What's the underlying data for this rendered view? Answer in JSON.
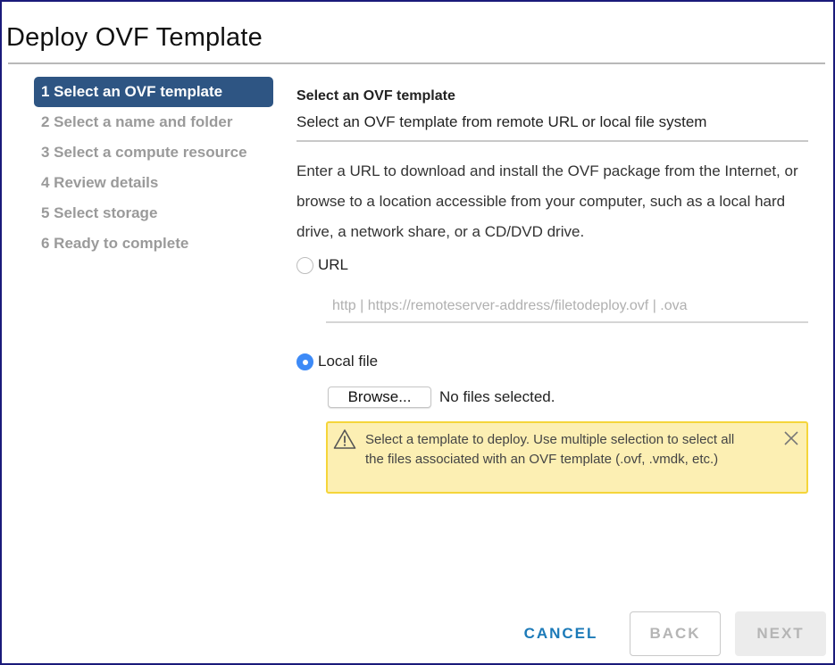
{
  "window": {
    "title": "Deploy OVF Template"
  },
  "steps": [
    {
      "label": "1 Select an OVF template",
      "active": true
    },
    {
      "label": "2 Select a name and folder",
      "active": false
    },
    {
      "label": "3 Select a compute resource",
      "active": false
    },
    {
      "label": "4 Review details",
      "active": false
    },
    {
      "label": "5 Select storage",
      "active": false
    },
    {
      "label": "6 Ready to complete",
      "active": false
    }
  ],
  "content": {
    "section_title": "Select an OVF template",
    "section_subtitle": "Select an OVF template from remote URL or local file system",
    "description": "Enter a URL to download and install the OVF package from the Internet, or browse to a location accessible from your computer, such as a local hard drive, a network share, or a CD/DVD drive.",
    "source_options": {
      "url": {
        "label": "URL",
        "checked": false
      },
      "local": {
        "label": "Local file",
        "checked": true
      }
    },
    "url_input": {
      "value": "",
      "placeholder": "http | https://remoteserver-address/filetodeploy.ovf | .ova"
    },
    "browse_button": "Browse...",
    "file_status": "No files selected.",
    "alert": {
      "icon": "warning-triangle-icon",
      "text": "Select a template to deploy. Use multiple selection to select all the files associated with an OVF template (.ovf, .vmdk, etc.)"
    }
  },
  "footer": {
    "cancel": "CANCEL",
    "back": "BACK",
    "next": "NEXT"
  },
  "colors": {
    "active_step": "#2e5583",
    "radio_checked": "#3d8af7",
    "cancel_link": "#1c7ab8",
    "alert_bg": "#fcefb3",
    "alert_border": "#f5d53a"
  }
}
